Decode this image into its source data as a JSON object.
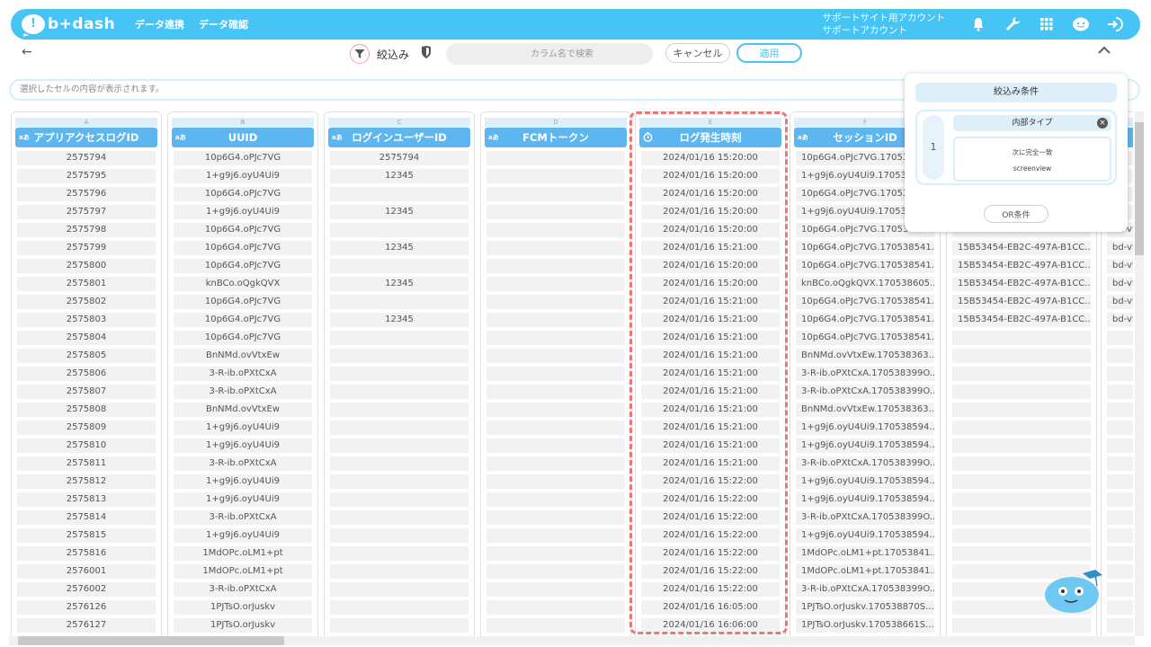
{
  "header": {
    "logo_text": "b+dash",
    "nav": [
      "データ連携",
      "データ確認"
    ],
    "account_line1": "サポートサイト用アカウント",
    "account_line2": "サポートアカウント",
    "icons": [
      "bell-icon",
      "wrench-icon",
      "grid-icon",
      "avatar-icon",
      "logout-icon"
    ]
  },
  "toolbar": {
    "filter_label": "絞込み",
    "search_placeholder": "カラム名で検索",
    "cancel_label": "キャンセル",
    "apply_label": "適用"
  },
  "cell_bar": {
    "placeholder": "選択したセルの内容が表示されます。"
  },
  "columns": [
    {
      "letter": "A",
      "type": "aあ",
      "name": "アプリアクセスログID",
      "align": "center",
      "cells": [
        "2575794",
        "2575795",
        "2575796",
        "2575797",
        "2575798",
        "2575799",
        "2575800",
        "2575801",
        "2575802",
        "2575803",
        "2575804",
        "2575805",
        "2575806",
        "2575807",
        "2575808",
        "2575809",
        "2575810",
        "2575811",
        "2575812",
        "2575813",
        "2575814",
        "2575815",
        "2575816",
        "2576001",
        "2576002",
        "2576126",
        "2576127"
      ]
    },
    {
      "letter": "B",
      "type": "aあ",
      "name": "UUID",
      "align": "center",
      "cells": [
        "10p6G4.oPJc7VG",
        "1+g9j6.oyU4Ui9",
        "10p6G4.oPJc7VG",
        "1+g9j6.oyU4Ui9",
        "10p6G4.oPJc7VG",
        "10p6G4.oPJc7VG",
        "10p6G4.oPJc7VG",
        "knBCo.oQgkQVX",
        "10p6G4.oPJc7VG",
        "10p6G4.oPJc7VG",
        "10p6G4.oPJc7VG",
        "BnNMd.ovVtxEw",
        "3-R-ib.oPXtCxA",
        "3-R-ib.oPXtCxA",
        "BnNMd.ovVtxEw",
        "1+g9j6.oyU4Ui9",
        "1+g9j6.oyU4Ui9",
        "3-R-ib.oPXtCxA",
        "1+g9j6.oyU4Ui9",
        "1+g9j6.oyU4Ui9",
        "3-R-ib.oPXtCxA",
        "1+g9j6.oyU4Ui9",
        "1MdOPc.oLM1+pt",
        "1MdOPc.oLM1+pt",
        "3-R-ib.oPXtCxA",
        "1PJTsO.orJuskv",
        "1PJTsO.orJuskv"
      ]
    },
    {
      "letter": "C",
      "type": "aあ",
      "name": "ログインユーザーID",
      "align": "center",
      "cells": [
        "2575794",
        "12345",
        "",
        "12345",
        "",
        "12345",
        "",
        "12345",
        "",
        "12345",
        "",
        "",
        "",
        "",
        "",
        "",
        "",
        "",
        "",
        "",
        "",
        "",
        "",
        "",
        "",
        "",
        ""
      ]
    },
    {
      "letter": "D",
      "type": "aあ",
      "name": "FCMトークン",
      "align": "center",
      "cells": [
        "",
        "",
        "",
        "",
        "",
        "",
        "",
        "",
        "",
        "",
        "",
        "",
        "",
        "",
        "",
        "",
        "",
        "",
        "",
        "",
        "",
        "",
        "",
        "",
        "",
        "",
        ""
      ]
    },
    {
      "letter": "E",
      "type": "clock",
      "name": "ログ発生時刻",
      "align": "center",
      "cells": [
        "2024/01/16 15:20:00",
        "2024/01/16 15:20:00",
        "2024/01/16 15:20:00",
        "2024/01/16 15:20:00",
        "2024/01/16 15:20:00",
        "2024/01/16 15:21:00",
        "2024/01/16 15:20:00",
        "2024/01/16 15:20:00",
        "2024/01/16 15:21:00",
        "2024/01/16 15:21:00",
        "2024/01/16 15:21:00",
        "2024/01/16 15:21:00",
        "2024/01/16 15:21:00",
        "2024/01/16 15:21:00",
        "2024/01/16 15:21:00",
        "2024/01/16 15:21:00",
        "2024/01/16 15:21:00",
        "2024/01/16 15:21:00",
        "2024/01/16 15:22:00",
        "2024/01/16 15:22:00",
        "2024/01/16 15:22:00",
        "2024/01/16 15:22:00",
        "2024/01/16 15:22:00",
        "2024/01/16 15:22:00",
        "2024/01/16 15:22:00",
        "2024/01/16 16:05:00",
        "2024/01/16 16:06:00"
      ]
    },
    {
      "letter": "F",
      "type": "aあ",
      "name": "セッションID",
      "align": "left",
      "cells": [
        "10p6G4.oPJc7VG.170538",
        "1+g9j6.oyU4Ui9.170538",
        "10p6G4.oPJc7VG.170538",
        "1+g9j6.oyU4Ui9.170538",
        "10p6G4.oPJc7VG.170538541...",
        "10p6G4.oPJc7VG.170538541...",
        "10p6G4.oPJc7VG.170538541...",
        "knBCo.oQgkQVX.170538605...",
        "10p6G4.oPJc7VG.170538541...",
        "10p6G4.oPJc7VG.170538541...",
        "10p6G4.oPJc7VG.170538541...",
        "BnNMd.ovVtxEw.170538363...",
        "3-R-ib.oPXtCxA.170538399O...",
        "3-R-ib.oPXtCxA.170538399O...",
        "BnNMd.ovVtxEw.170538363...",
        "1+g9j6.oyU4Ui9.170538594...",
        "1+g9j6.oyU4Ui9.170538594...",
        "3-R-ib.oPXtCxA.170538399O...",
        "1+g9j6.oyU4Ui9.170538594...",
        "1+g9j6.oyU4Ui9.170538594...",
        "3-R-ib.oPXtCxA.170538399O...",
        "1+g9j6.oyU4Ui9.170538594...",
        "1MdOPc.oLM1+pt.17053841...",
        "1MdOPc.oLM1+pt.17053841...",
        "3-R-ib.oPXtCxA.170538399O...",
        "1PJTsO.orJuskv.170538870S...",
        "1PJTsO.orJuskv.170538661S..."
      ]
    },
    {
      "letter": "G",
      "type": "aあ",
      "name": "",
      "align": "left",
      "cells": [
        "",
        "",
        "",
        "",
        "15B53454-EB2C-497A-B1CC...",
        "15B53454-EB2C-497A-B1CC...",
        "15B53454-EB2C-497A-B1CC...",
        "15B53454-EB2C-497A-B1CC...",
        "15B53454-EB2C-497A-B1CC...",
        "15B53454-EB2C-497A-B1CC...",
        "",
        "",
        "",
        "",
        "",
        "",
        "",
        "",
        "",
        "",
        "",
        "",
        "",
        "",
        "",
        "",
        ""
      ]
    },
    {
      "letter": "H",
      "type": "aあ",
      "name": "",
      "align": "left",
      "cells": [
        "",
        "",
        "",
        "",
        "bd-vt",
        "bd-vt",
        "bd-vt",
        "bd-vt",
        "bd-vt",
        "bd-vt",
        "",
        "",
        "",
        "",
        "",
        "",
        "",
        "",
        "",
        "",
        "",
        "",
        "",
        "",
        "",
        "",
        ""
      ]
    }
  ],
  "filter_panel": {
    "title": "絞込み条件",
    "condition_number": "1",
    "condition_type": "内部タイプ",
    "condition_operator": "次に完全一致",
    "condition_value": "screenview",
    "or_button": "OR条件"
  }
}
